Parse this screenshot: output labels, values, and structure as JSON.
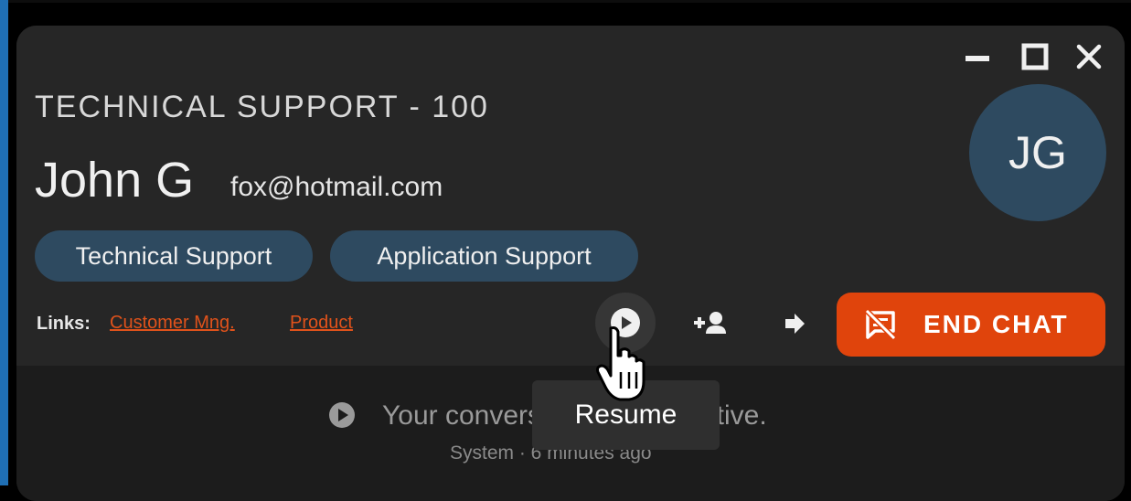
{
  "header": {
    "queue_title": "TECHNICAL SUPPORT - 100",
    "customer_name": "John G",
    "customer_email": "fox@hotmail.com",
    "tags": [
      "Technical Support",
      "Application Support"
    ],
    "links_label": "Links:",
    "links": [
      "Customer Mng.",
      "Product"
    ],
    "avatar_initials": "JG"
  },
  "window_controls": [
    "minimize-icon",
    "maximize-icon",
    "close-icon"
  ],
  "actions": {
    "resume_icon": "play-circle-icon",
    "add_participant_icon": "add-user-icon",
    "transfer_icon": "arrow-right-icon",
    "end_chat_label": "END CHAT",
    "end_chat_icon": "chat-off-icon"
  },
  "tooltip": {
    "text": "Resume"
  },
  "conversation": {
    "message_visible_start": "Your convers",
    "message_visible_end": "active.",
    "meta_visible": "System · 6 minutes ago"
  },
  "colors": {
    "window_bg": "#262626",
    "accent": "#e0440c",
    "tag_bg": "#2e4a60",
    "link": "#e0521b"
  }
}
